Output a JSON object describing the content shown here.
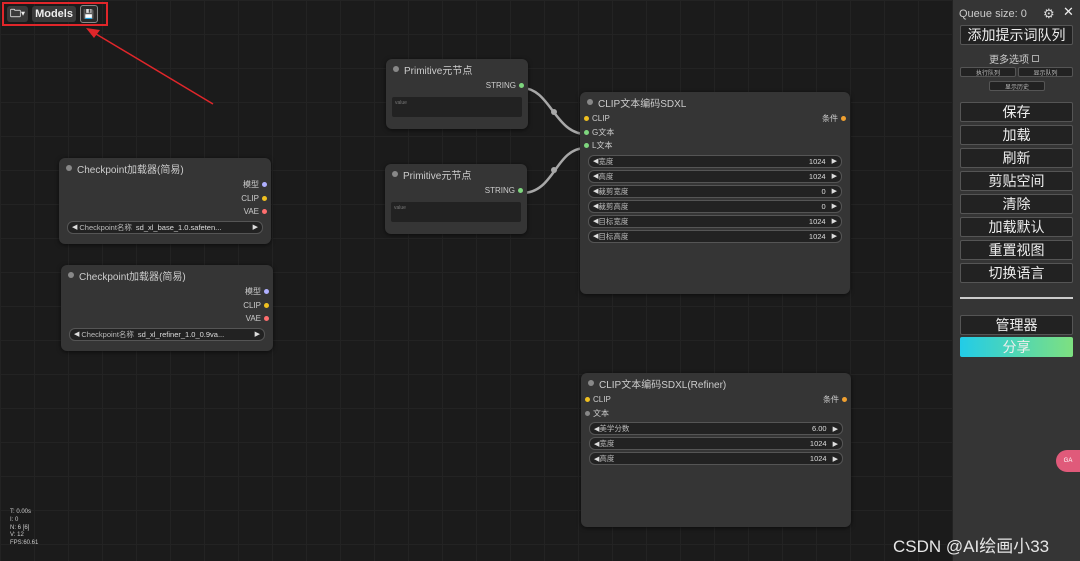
{
  "toolbar": {
    "folder_icon": "folder-icon",
    "models_label": "Models",
    "save_icon": "floppy-disk-icon"
  },
  "nodes": {
    "primitive1": {
      "title": "Primitive元节点",
      "output": "STRING",
      "placeholder": "value"
    },
    "primitive2": {
      "title": "Primitive元节点",
      "output": "STRING",
      "placeholder": "value"
    },
    "checkpoint1": {
      "title": "Checkpoint加载器(简易)",
      "outputs": [
        "模型",
        "CLIP",
        "VAE"
      ],
      "widget_label": "Checkpoint名称",
      "widget_value": "sd_xl_base_1.0.safeten..."
    },
    "checkpoint2": {
      "title": "Checkpoint加载器(简易)",
      "outputs": [
        "模型",
        "CLIP",
        "VAE"
      ],
      "widget_label": "Checkpoint名称",
      "widget_value": "sd_xl_refiner_1.0_0.9va..."
    },
    "clip_sdxl": {
      "title": "CLIP文本编码SDXL",
      "inputs": [
        "CLIP",
        "G文本",
        "L文本"
      ],
      "output": "条件",
      "widgets": [
        {
          "label": "宽度",
          "value": "1024"
        },
        {
          "label": "高度",
          "value": "1024"
        },
        {
          "label": "裁剪宽度",
          "value": "0"
        },
        {
          "label": "裁剪高度",
          "value": "0"
        },
        {
          "label": "目标宽度",
          "value": "1024"
        },
        {
          "label": "目标高度",
          "value": "1024"
        }
      ]
    },
    "clip_refiner": {
      "title": "CLIP文本编码SDXL(Refiner)",
      "inputs": [
        "CLIP",
        "文本"
      ],
      "output": "条件",
      "widgets": [
        {
          "label": "美学分数",
          "value": "6.00"
        },
        {
          "label": "宽度",
          "value": "1024"
        },
        {
          "label": "高度",
          "value": "1024"
        }
      ]
    }
  },
  "panel": {
    "queue_size": "Queue size: 0",
    "gear_icon": "gear-icon",
    "close_icon": "close-icon",
    "queue_prompt": "添加提示词队列",
    "more_options": "更多选项",
    "small_buttons": [
      "执行队列",
      "显示队列",
      "显示历史"
    ],
    "buttons": [
      "保存",
      "加载",
      "刷新",
      "剪贴空间",
      "清除",
      "加载默认",
      "重置视图",
      "切换语言"
    ],
    "manager": "管理器",
    "share": "分享"
  },
  "stats": [
    "T: 0.00s",
    "I: 0",
    "N: 6 [6]",
    "V: 12",
    "FPS:60.61"
  ],
  "watermark": "CSDN @AI绘画小33",
  "badge": "GA",
  "colors": {
    "accent_red": "#e0262a",
    "clip": "#f0c020",
    "vae": "#ff6e6e",
    "model": "#b0b0ff",
    "string": "#7ed67e",
    "share_start": "#22cce8",
    "share_end": "#7ee080"
  }
}
